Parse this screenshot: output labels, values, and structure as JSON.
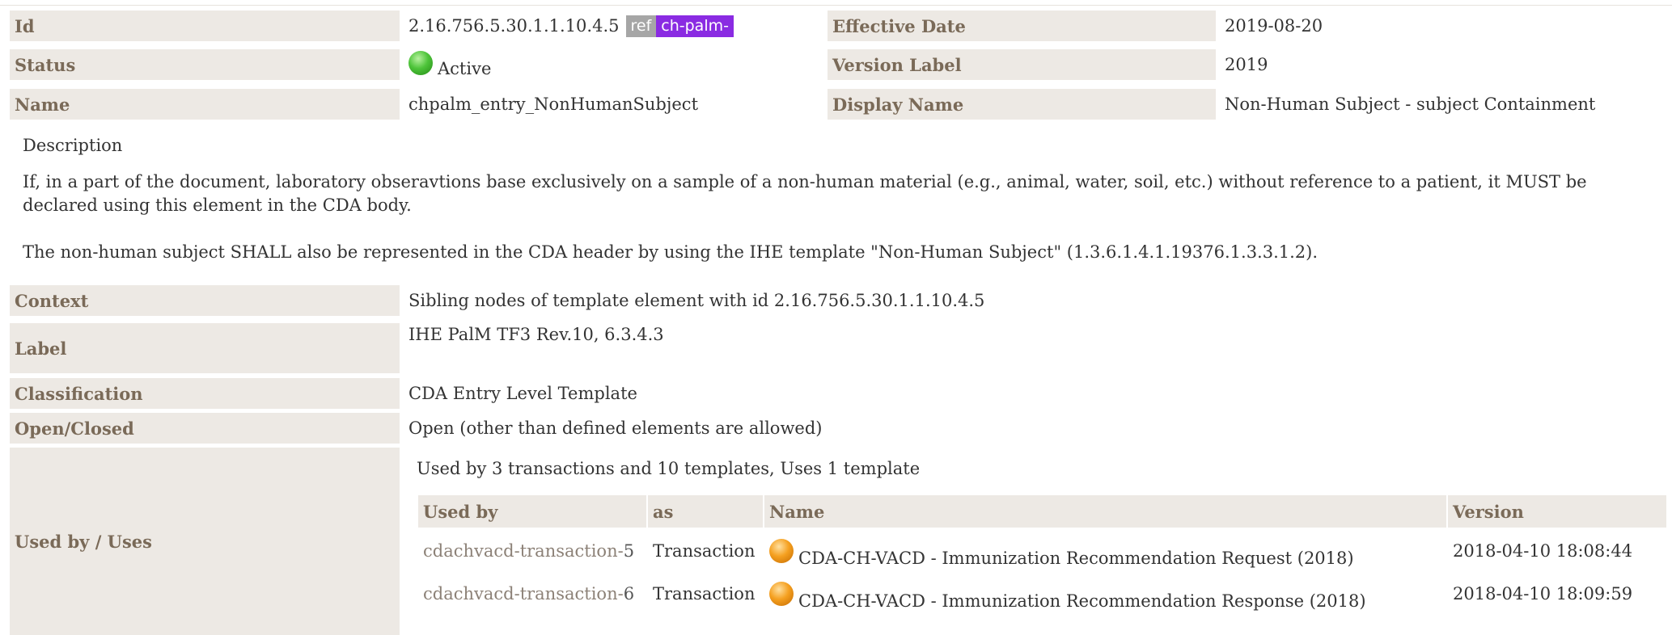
{
  "header": {
    "id_label": "Id",
    "id_value": "2.16.756.5.30.1.1.10.4.5",
    "id_tag_ref": "ref",
    "id_tag_prefix": "ch-palm-",
    "effective_date_label": "Effective Date",
    "effective_date_value": "2019-08-20",
    "status_label": "Status",
    "status_value": "Active",
    "status_icon": "green-status-icon",
    "version_label_label": "Version Label",
    "version_label_value": "2019",
    "name_label": "Name",
    "name_value": "chpalm_entry_NonHumanSubject",
    "display_name_label": "Display Name",
    "display_name_value": "Non-Human Subject - subject Containment"
  },
  "description": {
    "title": "Description",
    "paragraph1": "If, in a part of the document, laboratory obseravtions base exclusively on a sample of a non-human material (e.g., animal, water, soil, etc.) without reference to a patient, it MUST be declared using this element in the CDA body.",
    "paragraph2": "The non-human subject SHALL also be represented in the CDA header by using the IHE template \"Non-Human Subject\" (1.3.6.1.4.1.19376.1.3.3.1.2)."
  },
  "details": {
    "context_label": "Context",
    "context_value": "Sibling nodes of template element with id 2.16.756.5.30.1.1.10.4.5",
    "label_label": "Label",
    "label_value": "IHE PalM TF3 Rev.10, 6.3.4.3",
    "classification_label": "Classification",
    "classification_value": "CDA Entry Level Template",
    "open_closed_label": "Open/Closed",
    "open_closed_value": "Open (other than defined elements are allowed)",
    "used_by_label": "Used by / Uses",
    "used_by_summary": "Used by 3 transactions and 10 templates, Uses 1 template"
  },
  "usage_table": {
    "columns": [
      "Used by",
      "as",
      "Name",
      "Version"
    ],
    "rows": [
      {
        "link_text": "cdachvacd-transaction-",
        "link_num": "5",
        "as": "Transaction",
        "status_icon": "orange-status-icon",
        "name": "CDA-CH-VACD - Immunization Recommendation Request (2018)",
        "version": "2018-04-10 18:08:44"
      },
      {
        "link_text": "cdachvacd-transaction-",
        "link_num": "6",
        "as": "Transaction",
        "status_icon": "orange-status-icon",
        "name": "CDA-CH-VACD - Immunization Recommendation Response (2018)",
        "version": "2018-04-10 18:09:59"
      }
    ]
  },
  "colors": {
    "label_background": "#ede9e4",
    "label_text": "#7a6a58",
    "ref_tag": "#a6a6a6",
    "id_tag": "#8a2be2",
    "link_text": "#8c8177"
  }
}
